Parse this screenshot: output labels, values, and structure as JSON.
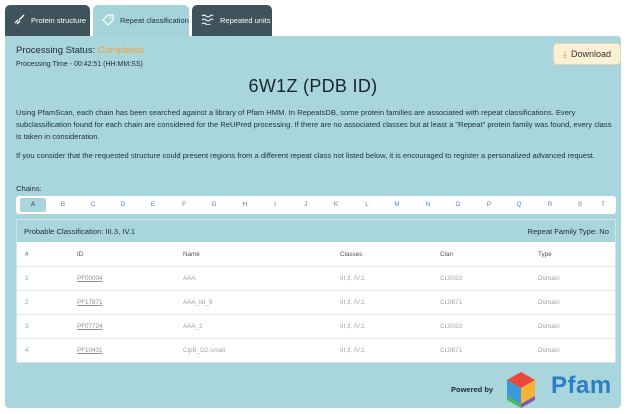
{
  "tabs": [
    {
      "label": "Protein structure",
      "icon": "protein-structure-icon",
      "active": false
    },
    {
      "label": "Repeat classification",
      "icon": "tag-icon",
      "active": true
    },
    {
      "label": "Repeated units",
      "icon": "repeat-units-icon",
      "active": false
    }
  ],
  "status": {
    "label": "Processing Status:",
    "value": "Completed",
    "value_color": "#f0a13a",
    "time": "Processing Time - 00:42:51 (HH:MM:SS)"
  },
  "download": {
    "label": "Download",
    "icon": "download-icon"
  },
  "title": "6W1Z (PDB ID)",
  "description": {
    "paragraph_1": "Using PfamScan, each chain has been searched against a library of Pfam HMM. In RepeatsDB, some protein families are associated with repeat classifications. Every subclassification found for each chain are considered for the ReUPred processing. If there are no associated classes but at least a \"Repeat\" protein family was found, every class is taken in consideration.",
    "paragraph_2": "If you consider that the requested structure could present regions from a different repeat class not listed below, it is encouraged to register a personalized advanced request."
  },
  "chains": {
    "label": "Chains:",
    "items": [
      "A",
      "B",
      "C",
      "D",
      "E",
      "F",
      "G",
      "H",
      "I",
      "J",
      "K",
      "L",
      "M",
      "N",
      "O",
      "P",
      "Q",
      "R",
      "S",
      "T"
    ],
    "selected": "A"
  },
  "classification": {
    "probable": "Probable Classification: III.3, IV.1",
    "repeat_family_type": "Repeat Family Type: No",
    "columns": [
      "#",
      "ID",
      "Name",
      "Classes",
      "Clan",
      "Type"
    ],
    "rows": [
      {
        "num": "1",
        "id": "PF00004",
        "name": "AAA",
        "classes": "III.3, IV.1",
        "clan": "CL0023",
        "type": "Domain"
      },
      {
        "num": "2",
        "id": "PF17871",
        "name": "AAA_lid_9",
        "classes": "III.3, IV.1",
        "clan": "CL0671",
        "type": "Domain"
      },
      {
        "num": "3",
        "id": "PF07724",
        "name": "AAA_2",
        "classes": "III.3, IV.1",
        "clan": "CL0023",
        "type": "Domain"
      },
      {
        "num": "4",
        "id": "PF10431",
        "name": "ClpB_D2-small",
        "classes": "III.3, IV.1",
        "clan": "CL0671",
        "type": "Domain"
      }
    ]
  },
  "footer": {
    "powered_by": "Powered by",
    "logo_text": "Pfam",
    "logo_color": "#2b7fc6"
  }
}
